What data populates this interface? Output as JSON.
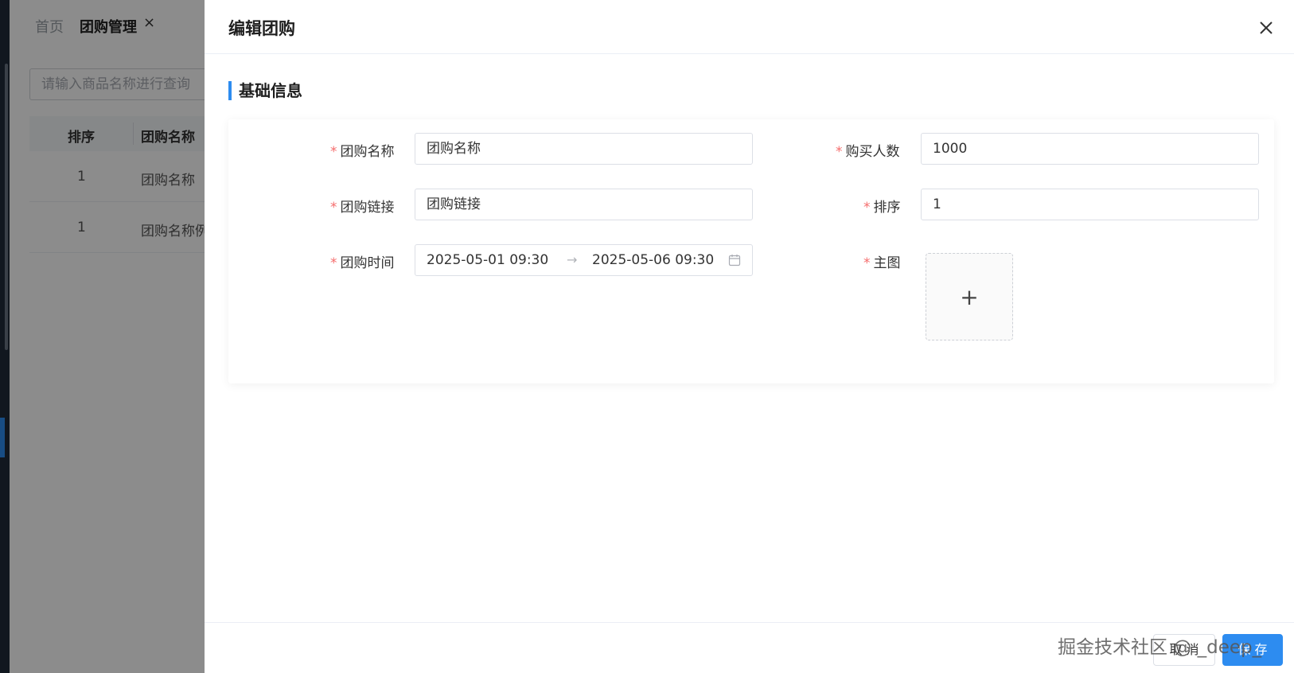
{
  "background": {
    "tabs": {
      "home": "首页",
      "active": "团购管理",
      "close_glyph": "×"
    },
    "search": {
      "placeholder": "请输入商品名称进行查询"
    },
    "table": {
      "headers": [
        "排序",
        "团购名称"
      ],
      "rows": [
        {
          "order": "1",
          "name": "团购名称"
        },
        {
          "order": "1",
          "name": "团购名称例"
        }
      ]
    }
  },
  "drawer": {
    "title": "编辑团购",
    "close_icon": "close-icon",
    "section_title": "基础信息",
    "required_mark": "*",
    "fields": {
      "name": {
        "label": "团购名称",
        "value": "团购名称"
      },
      "link": {
        "label": "团购链接",
        "value": "团购链接"
      },
      "time": {
        "label": "团购时间",
        "start": "2025-05-01 09:30",
        "arrow": "→",
        "end": "2025-05-06 09:30"
      },
      "buyers": {
        "label": "购买人数",
        "value": "1000"
      },
      "order": {
        "label": "排序",
        "value": "1"
      },
      "image": {
        "label": "主图",
        "plus": "+"
      }
    },
    "footer": {
      "cancel_label": "取 消",
      "save_label": "保 存",
      "watermark": "掘金技术社区 @ _deep_"
    }
  },
  "colors": {
    "primary": "#2d8cf0",
    "required": "#f56c6c",
    "sidebar": "#1f2a3a"
  }
}
